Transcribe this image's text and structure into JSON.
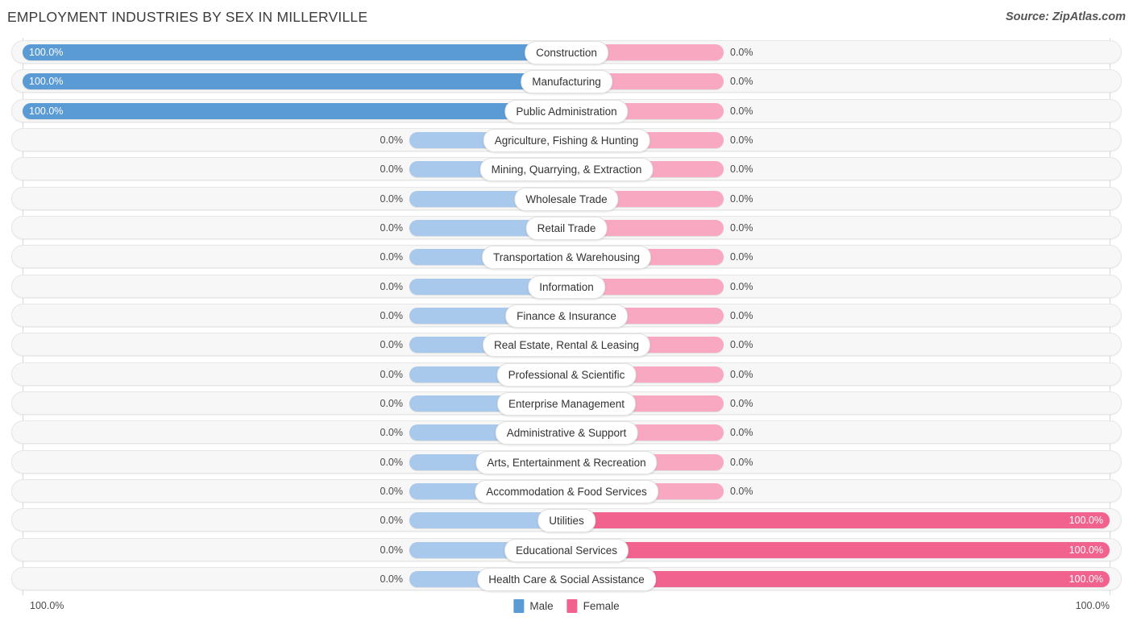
{
  "header": {
    "title": "EMPLOYMENT INDUSTRIES BY SEX IN MILLERVILLE",
    "source": "Source: ZipAtlas.com"
  },
  "legend": {
    "male_label": "Male",
    "female_label": "Female",
    "male_color": "#5B9BD5",
    "female_color": "#F2628F",
    "male_color_light": "#A8C8EC",
    "female_color_light": "#F9A8C2"
  },
  "axis": {
    "left_label": "100.0%",
    "right_label": "100.0%"
  },
  "chart_data": {
    "type": "bar",
    "title": "EMPLOYMENT INDUSTRIES BY SEX IN MILLERVILLE",
    "subtitle": "",
    "xlabel": "",
    "ylabel": "",
    "orientation": "horizontal-diverging",
    "xlim": [
      0,
      100
    ],
    "grid": true,
    "legend_position": "bottom-center",
    "categories": [
      "Construction",
      "Manufacturing",
      "Public Administration",
      "Agriculture, Fishing & Hunting",
      "Mining, Quarrying, & Extraction",
      "Wholesale Trade",
      "Retail Trade",
      "Transportation & Warehousing",
      "Information",
      "Finance & Insurance",
      "Real Estate, Rental & Leasing",
      "Professional & Scientific",
      "Enterprise Management",
      "Administrative & Support",
      "Arts, Entertainment & Recreation",
      "Accommodation & Food Services",
      "Utilities",
      "Educational Services",
      "Health Care & Social Assistance"
    ],
    "series": [
      {
        "name": "Male",
        "values": [
          100.0,
          100.0,
          100.0,
          0.0,
          0.0,
          0.0,
          0.0,
          0.0,
          0.0,
          0.0,
          0.0,
          0.0,
          0.0,
          0.0,
          0.0,
          0.0,
          0.0,
          0.0,
          0.0
        ]
      },
      {
        "name": "Female",
        "values": [
          0.0,
          0.0,
          0.0,
          0.0,
          0.0,
          0.0,
          0.0,
          0.0,
          0.0,
          0.0,
          0.0,
          0.0,
          0.0,
          0.0,
          0.0,
          0.0,
          100.0,
          100.0,
          100.0
        ]
      }
    ]
  },
  "rows": [
    {
      "label": "Construction",
      "male": "100.0%",
      "female": "0.0%",
      "male_pct": 100,
      "female_pct": 0
    },
    {
      "label": "Manufacturing",
      "male": "100.0%",
      "female": "0.0%",
      "male_pct": 100,
      "female_pct": 0
    },
    {
      "label": "Public Administration",
      "male": "100.0%",
      "female": "0.0%",
      "male_pct": 100,
      "female_pct": 0
    },
    {
      "label": "Agriculture, Fishing & Hunting",
      "male": "0.0%",
      "female": "0.0%",
      "male_pct": 0,
      "female_pct": 0
    },
    {
      "label": "Mining, Quarrying, & Extraction",
      "male": "0.0%",
      "female": "0.0%",
      "male_pct": 0,
      "female_pct": 0
    },
    {
      "label": "Wholesale Trade",
      "male": "0.0%",
      "female": "0.0%",
      "male_pct": 0,
      "female_pct": 0
    },
    {
      "label": "Retail Trade",
      "male": "0.0%",
      "female": "0.0%",
      "male_pct": 0,
      "female_pct": 0
    },
    {
      "label": "Transportation & Warehousing",
      "male": "0.0%",
      "female": "0.0%",
      "male_pct": 0,
      "female_pct": 0
    },
    {
      "label": "Information",
      "male": "0.0%",
      "female": "0.0%",
      "male_pct": 0,
      "female_pct": 0
    },
    {
      "label": "Finance & Insurance",
      "male": "0.0%",
      "female": "0.0%",
      "male_pct": 0,
      "female_pct": 0
    },
    {
      "label": "Real Estate, Rental & Leasing",
      "male": "0.0%",
      "female": "0.0%",
      "male_pct": 0,
      "female_pct": 0
    },
    {
      "label": "Professional & Scientific",
      "male": "0.0%",
      "female": "0.0%",
      "male_pct": 0,
      "female_pct": 0
    },
    {
      "label": "Enterprise Management",
      "male": "0.0%",
      "female": "0.0%",
      "male_pct": 0,
      "female_pct": 0
    },
    {
      "label": "Administrative & Support",
      "male": "0.0%",
      "female": "0.0%",
      "male_pct": 0,
      "female_pct": 0
    },
    {
      "label": "Arts, Entertainment & Recreation",
      "male": "0.0%",
      "female": "0.0%",
      "male_pct": 0,
      "female_pct": 0
    },
    {
      "label": "Accommodation & Food Services",
      "male": "0.0%",
      "female": "0.0%",
      "male_pct": 0,
      "female_pct": 0
    },
    {
      "label": "Utilities",
      "male": "0.0%",
      "female": "100.0%",
      "male_pct": 0,
      "female_pct": 100
    },
    {
      "label": "Educational Services",
      "male": "0.0%",
      "female": "100.0%",
      "male_pct": 0,
      "female_pct": 100
    },
    {
      "label": "Health Care & Social Assistance",
      "male": "0.0%",
      "female": "100.0%",
      "male_pct": 0,
      "female_pct": 100
    }
  ]
}
